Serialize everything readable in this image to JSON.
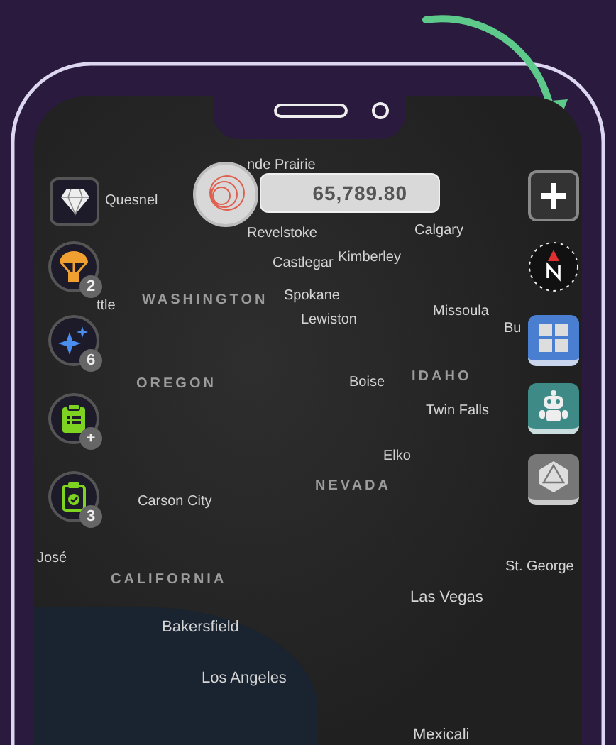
{
  "balance": {
    "amount": "65,789.80"
  },
  "left_buttons": [
    {
      "kind": "gem"
    },
    {
      "kind": "supply-drop",
      "badge": "2"
    },
    {
      "kind": "sparkle",
      "badge": "6"
    },
    {
      "kind": "clipboard-list",
      "badge": "+"
    },
    {
      "kind": "clipboard-check",
      "badge": "3"
    }
  ],
  "map_labels": [
    {
      "text": "nde Prairie",
      "kind": "city"
    },
    {
      "text": "Quesnel",
      "kind": "city"
    },
    {
      "text": "Revelstoke",
      "kind": "city"
    },
    {
      "text": "Calgary",
      "kind": "city"
    },
    {
      "text": "Castlegar",
      "kind": "city"
    },
    {
      "text": "Kimberley",
      "kind": "city"
    },
    {
      "text": "ttle",
      "kind": "city"
    },
    {
      "text": "WASHINGTON",
      "kind": "state"
    },
    {
      "text": "Spokane",
      "kind": "city"
    },
    {
      "text": "Lewiston",
      "kind": "city"
    },
    {
      "text": "Missoula",
      "kind": "city"
    },
    {
      "text": "Bu",
      "kind": "city"
    },
    {
      "text": "OREGON",
      "kind": "state"
    },
    {
      "text": "Boise",
      "kind": "city"
    },
    {
      "text": "IDAHO",
      "kind": "state"
    },
    {
      "text": "Twin Falls",
      "kind": "city"
    },
    {
      "text": "Elko",
      "kind": "city"
    },
    {
      "text": "NEVADA",
      "kind": "state"
    },
    {
      "text": "Carson City",
      "kind": "city"
    },
    {
      "text": "José",
      "kind": "city"
    },
    {
      "text": "CALIFORNIA",
      "kind": "state"
    },
    {
      "text": "St. George",
      "kind": "city"
    },
    {
      "text": "Las Vegas",
      "kind": "city"
    },
    {
      "text": "Bakersfield",
      "kind": "city"
    },
    {
      "text": "Los Angeles",
      "kind": "city"
    },
    {
      "text": "Mexicali",
      "kind": "city"
    }
  ]
}
